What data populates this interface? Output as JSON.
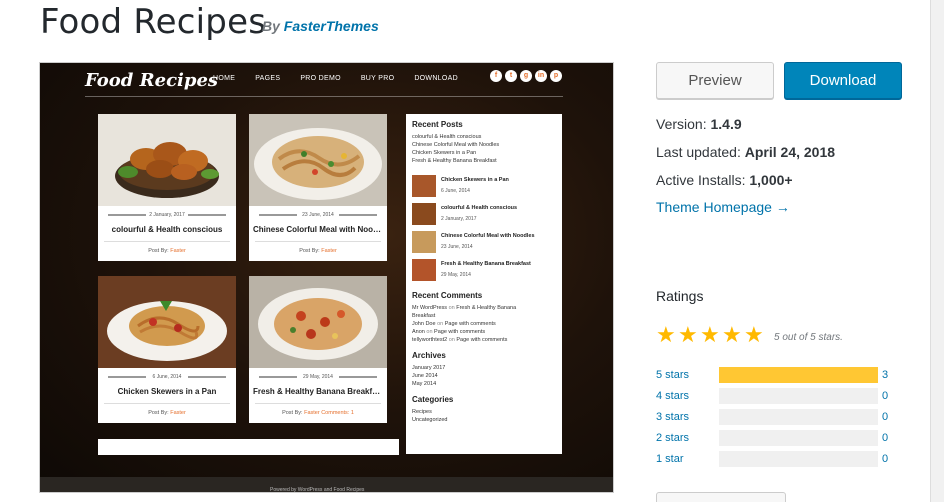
{
  "header": {
    "title": "Food Recipes",
    "by_prefix": "By",
    "author": "FasterThemes"
  },
  "screenshot": {
    "logo_text": "Food Recipes",
    "menu": [
      "HOME",
      "PAGES",
      "PRO DEMO",
      "BUY PRO",
      "DOWNLOAD"
    ],
    "social": [
      "f",
      "t",
      "g",
      "in",
      "p"
    ],
    "posts": [
      {
        "date": "2 January, 2017",
        "title": "colourful & Health conscious",
        "meta_prefix": "Post By:",
        "author": "Faster",
        "comments": ""
      },
      {
        "date": "23 June, 2014",
        "title": "Chinese Colorful Meal with Nood...",
        "meta_prefix": "Post By:",
        "author": "Faster",
        "comments": ""
      },
      {
        "date": "6 June, 2014",
        "title": "Chicken Skewers in a Pan",
        "meta_prefix": "Post By:",
        "author": "Faster",
        "comments": ""
      },
      {
        "date": "29 May, 2014",
        "title": "Fresh & Healthy Banana Breakfast",
        "meta_prefix": "Post By:",
        "author": "Faster",
        "comments": "Comments: 1"
      }
    ],
    "sidebar": {
      "recent_posts_heading": "Recent Posts",
      "recent_links": [
        "colourful & Health conscious",
        "Chinese Colorful Meal with Noodles",
        "Chicken Skewers in a Pan",
        "Fresh & Healthy Banana Breakfast"
      ],
      "thumb_posts": [
        {
          "title": "Chicken Skewers in a Pan",
          "date": "6 June, 2014"
        },
        {
          "title": "colourful & Health conscious",
          "date": "2 January, 2017"
        },
        {
          "title": "Chinese Colorful Meal with Noodles",
          "date": "23 June, 2014"
        },
        {
          "title": "Fresh & Healthy Banana Breakfast",
          "date": "29 May, 2014"
        }
      ],
      "recent_comments_heading": "Recent Comments",
      "comments": [
        {
          "who": "Mr WordPress",
          "on": "on",
          "post": "Fresh & Healthy Banana"
        },
        {
          "who": "Breakfast",
          "on": "",
          "post": ""
        },
        {
          "who": "John Doe",
          "on": "on",
          "post": "Page with comments"
        },
        {
          "who": "Anon",
          "on": "on",
          "post": "Page with comments"
        },
        {
          "who": "tellyworthtest2",
          "on": "on",
          "post": "Page with comments"
        }
      ],
      "archives_heading": "Archives",
      "archives": [
        "January 2017",
        "June 2014",
        "May 2014"
      ],
      "categories_heading": "Categories",
      "categories": [
        "Recipes",
        "Uncategorized"
      ]
    },
    "footer_text": "Powered by WordPress and Food Recipes"
  },
  "actions": {
    "preview_label": "Preview",
    "download_label": "Download"
  },
  "details": {
    "version_label": "Version:",
    "version": "1.4.9",
    "updated_label": "Last updated:",
    "updated": "April 24, 2018",
    "installs_label": "Active Installs:",
    "installs": "1,000+",
    "homepage_label": "Theme Homepage →"
  },
  "ratings": {
    "heading": "Ratings",
    "stars_note": "5 out of 5 stars.",
    "rows": [
      {
        "label": "5 stars",
        "count": "3",
        "fraction": 1.0
      },
      {
        "label": "4 stars",
        "count": "0",
        "fraction": 0
      },
      {
        "label": "3 stars",
        "count": "0",
        "fraction": 0
      },
      {
        "label": "2 stars",
        "count": "0",
        "fraction": 0
      },
      {
        "label": "1 star",
        "count": "0",
        "fraction": 0
      }
    ]
  },
  "colors": {
    "link": "#0073aa",
    "download_bg": "#0085ba",
    "star": "#ffb900",
    "bar_fill": "#ffc733",
    "accent": "#e56f2c"
  }
}
